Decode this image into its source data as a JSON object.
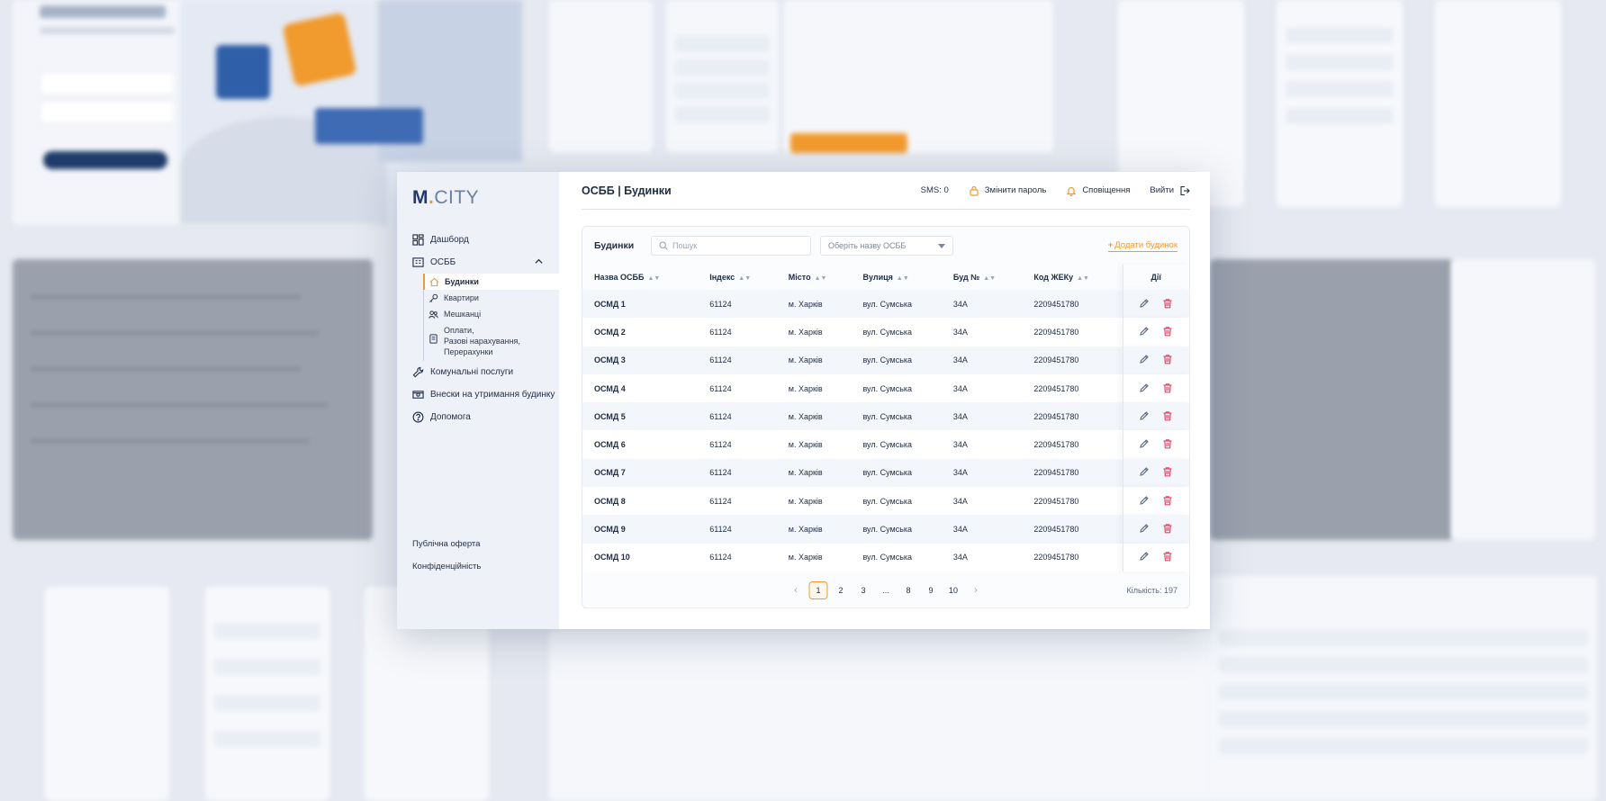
{
  "brand": {
    "main": "M",
    "dot": ".",
    "rest": "CITY"
  },
  "sidebar": {
    "items": [
      {
        "label": "Дашборд"
      },
      {
        "label": "ОСББ"
      },
      {
        "label": "Комунальні послуги"
      },
      {
        "label": "Внески на утримання будинку"
      },
      {
        "label": "Допомога"
      }
    ],
    "subitems": [
      {
        "label": "Будинки"
      },
      {
        "label": "Квартири"
      },
      {
        "label": "Мешканці"
      },
      {
        "label": "Оплати,\nРазові нарахування,\nПерерахунки"
      }
    ],
    "footer": [
      {
        "label": "Публічна оферта"
      },
      {
        "label": "Конфіденційність"
      }
    ]
  },
  "header": {
    "title": "ОСББ | Будинки",
    "sms": "SMS: 0",
    "change_password": "Змінити пароль",
    "notifications": "Сповіщення",
    "logout": "Вийти"
  },
  "card": {
    "title": "Будинки",
    "search_placeholder": "Пошук",
    "select_placeholder": "Оберіть назву ОСББ",
    "add_button": "Додати будинок"
  },
  "table": {
    "columns": [
      "Назва ОСББ",
      "Індекс",
      "Місто",
      "Вулиця",
      "Буд №",
      "Код ЖЕКу",
      "Дії"
    ],
    "rows": [
      [
        "ОСМД 1",
        "61124",
        "м. Харків",
        "вул. Сумська",
        "34А",
        "2209451780"
      ],
      [
        "ОСМД 2",
        "61124",
        "м. Харків",
        "вул. Сумська",
        "34А",
        "2209451780"
      ],
      [
        "ОСМД 3",
        "61124",
        "м. Харків",
        "вул. Сумська",
        "34А",
        "2209451780"
      ],
      [
        "ОСМД 4",
        "61124",
        "м. Харків",
        "вул. Сумська",
        "34А",
        "2209451780"
      ],
      [
        "ОСМД 5",
        "61124",
        "м. Харків",
        "вул. Сумська",
        "34А",
        "2209451780"
      ],
      [
        "ОСМД 6",
        "61124",
        "м. Харків",
        "вул. Сумська",
        "34А",
        "2209451780"
      ],
      [
        "ОСМД 7",
        "61124",
        "м. Харків",
        "вул. Сумська",
        "34А",
        "2209451780"
      ],
      [
        "ОСМД 8",
        "61124",
        "м. Харків",
        "вул. Сумська",
        "34А",
        "2209451780"
      ],
      [
        "ОСМД 9",
        "61124",
        "м. Харків",
        "вул. Сумська",
        "34А",
        "2209451780"
      ],
      [
        "ОСМД 10",
        "61124",
        "м. Харків",
        "вул. Сумська",
        "34А",
        "2209451780"
      ]
    ]
  },
  "pagination": {
    "pages": [
      "1",
      "2",
      "3",
      "...",
      "8",
      "9",
      "10"
    ],
    "current": "1",
    "prev": "‹",
    "next": "›",
    "count": "Кількість: 197"
  },
  "colors": {
    "accent": "#f19a2d",
    "brand_dark": "#1e3b6b",
    "delete": "#e2476a",
    "sidebar_bg": "#eef1f8"
  },
  "icons": {
    "dashboard": "dashboard-icon",
    "osbb": "building-icon",
    "utilities": "wrench-icon",
    "fees": "cash-icon",
    "help": "help-icon",
    "houses": "home-icon",
    "apartments": "key-icon",
    "residents": "people-icon",
    "payments": "receipt-icon",
    "change_password": "lock-icon",
    "notifications": "bell-icon",
    "logout": "logout-icon",
    "search": "search-icon",
    "edit": "pencil-icon",
    "delete": "trash-icon"
  }
}
